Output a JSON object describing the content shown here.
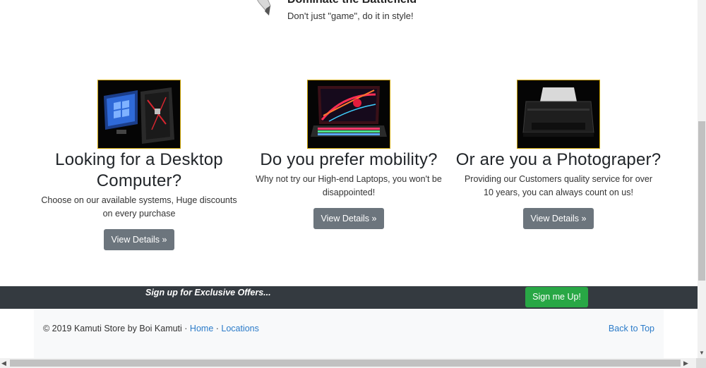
{
  "top_feature": {
    "title": "Dominate the Battlefield",
    "subtitle": "Don't just \"game\", do it in style!",
    "icon": "pen-icon"
  },
  "products": [
    {
      "image": "desktop-computer-image",
      "heading": "Looking for a Desktop Computer?",
      "text": "Choose on our available systems, Huge discounts on every purchase",
      "button": "View Details »"
    },
    {
      "image": "gaming-laptop-image",
      "heading": "Do you prefer mobility?",
      "text": "Why not try our High-end Laptops, you won't be disappointed!",
      "button": "View Details »"
    },
    {
      "image": "printer-image",
      "heading": "Or are you a Photograper?",
      "text": "Providing our Customers quality service for over 10 years, you can always count on us!",
      "button": "View Details »"
    }
  ],
  "signup": {
    "text": "Sign up for Exclusive Offers...",
    "button": "Sign me Up!"
  },
  "footer": {
    "copyright": "© 2019 Kamuti Store by Boi Kamuti · ",
    "link_home": "Home",
    "separator": " · ",
    "link_locations": "Locations",
    "back_to_top": "Back to Top"
  },
  "colors": {
    "button_gray": "#6c757d",
    "signup_green": "#28a745",
    "dark_bar": "#343a40",
    "link_blue": "#2b7bc9",
    "thumb_border": "#c9a100"
  }
}
